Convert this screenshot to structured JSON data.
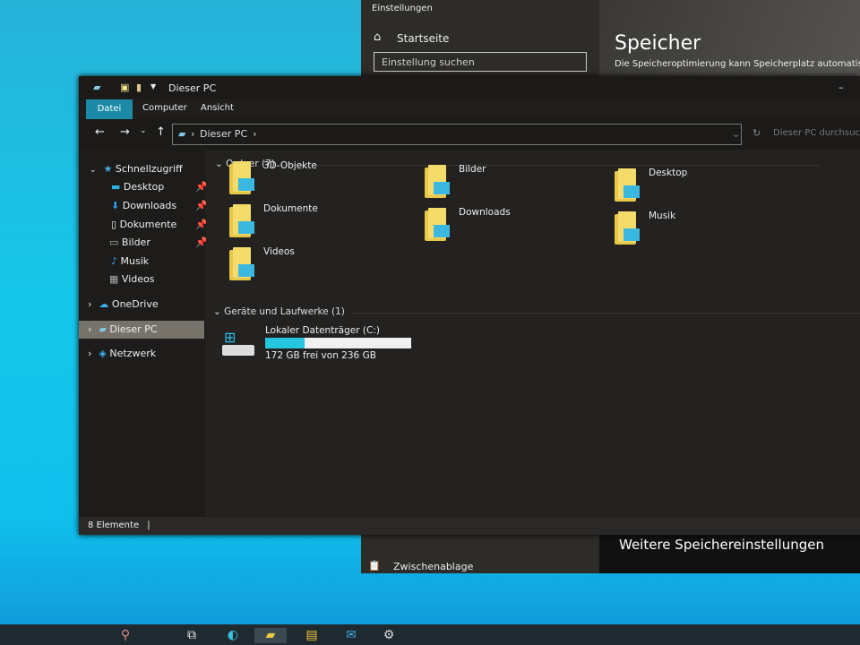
{
  "settings": {
    "title": "Einstellungen",
    "home": "Startseite",
    "search_placeholder": "Einstellung suchen",
    "page_title": "Speicher",
    "description": "Die Speicheroptimierung kann Speicherplatz automatisch",
    "more": "Weitere Speichereinstellungen",
    "clipboard": "Zwischenablage"
  },
  "explorer": {
    "title": "Dieser PC",
    "ribbon_tabs": [
      "Datei",
      "Computer",
      "Ansicht"
    ],
    "address": "Dieser PC",
    "search_placeholder": "Dieser PC durchsuchen",
    "nav": {
      "quick_access": "Schnellzugriff",
      "quick_items": [
        {
          "label": "Desktop",
          "pinned": true
        },
        {
          "label": "Downloads",
          "pinned": true
        },
        {
          "label": "Dokumente",
          "pinned": true
        },
        {
          "label": "Bilder",
          "pinned": true
        },
        {
          "label": "Musik",
          "pinned": false
        },
        {
          "label": "Videos",
          "pinned": false
        }
      ],
      "onedrive": "OneDrive",
      "this_pc": "Dieser PC",
      "network": "Netzwerk"
    },
    "folders_header": "Ordner (7)",
    "folders": [
      "3D-Objekte",
      "Bilder",
      "Desktop",
      "Dokumente",
      "Downloads",
      "Musik",
      "Videos"
    ],
    "drives_header": "Geräte und Laufwerke (1)",
    "drive": {
      "name": "Lokaler Datenträger (C:)",
      "free_text": "172 GB frei von 236 GB",
      "used_fraction": 0.27,
      "bar_color": "#26c6e0"
    },
    "status": "8 Elemente"
  },
  "colors": {
    "accent": "#1a8aa6",
    "desktop": "#16c6e8"
  }
}
